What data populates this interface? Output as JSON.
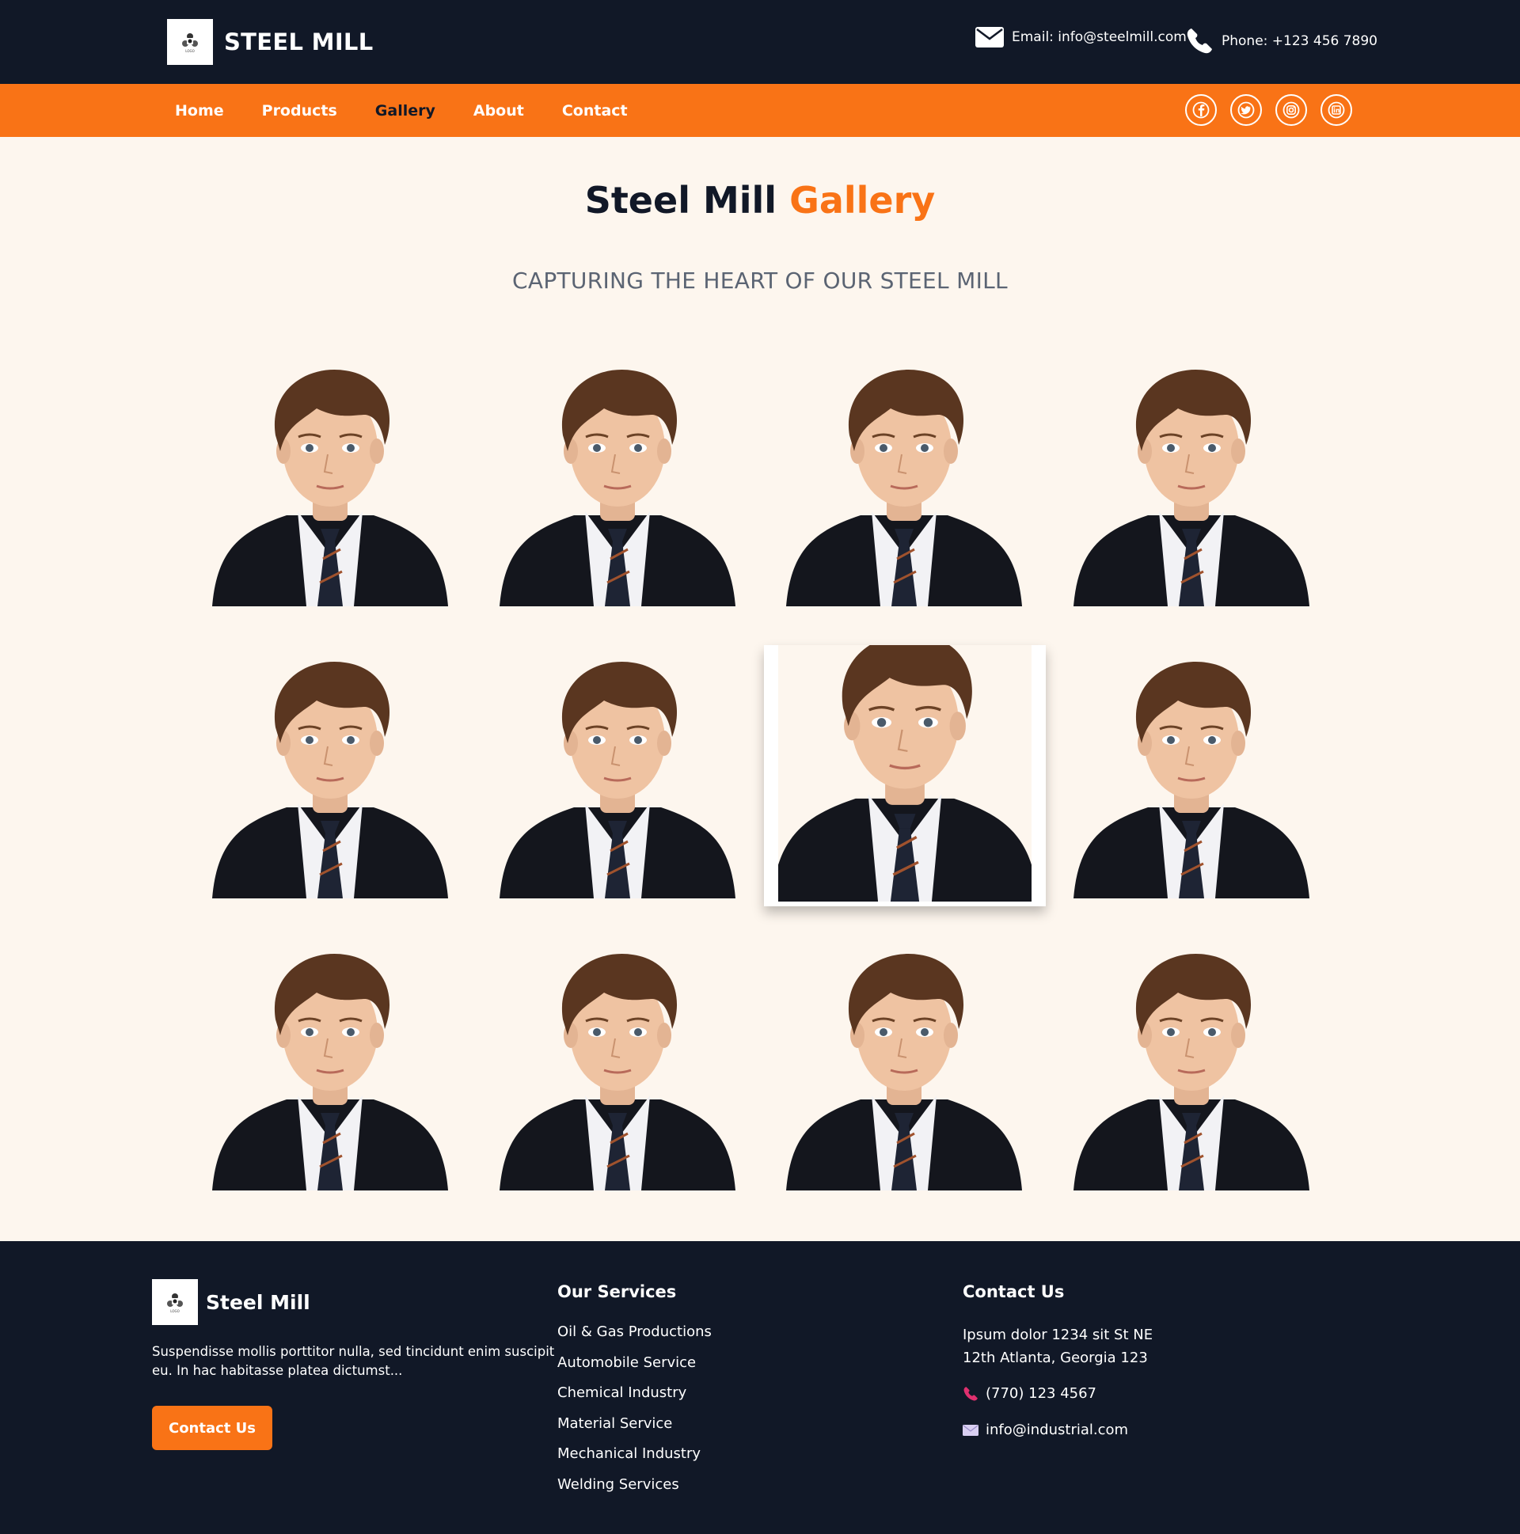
{
  "header": {
    "brand": "STEEL MILL",
    "email": "Email: info@steelmill.com",
    "phone": "Phone: +123 456 7890"
  },
  "nav": {
    "items": [
      {
        "label": "Home",
        "active": false
      },
      {
        "label": "Products",
        "active": false
      },
      {
        "label": "Gallery",
        "active": true
      },
      {
        "label": "About",
        "active": false
      },
      {
        "label": "Contact",
        "active": false
      }
    ],
    "socials": [
      "facebook-icon",
      "twitter-icon",
      "instagram-icon",
      "linkedin-icon"
    ]
  },
  "page": {
    "title_part1": "Steel Mill",
    "title_part2": "Gallery",
    "subtitle": "CAPTURING THE HEART OF OUR STEEL MILL"
  },
  "gallery": {
    "rows": 3,
    "columns": 4,
    "highlighted_index": 6
  },
  "footer": {
    "brand": "Steel Mill",
    "description": "Suspendisse mollis porttitor nulla, sed tincidunt enim suscipit eu. In hac habitasse platea dictumst...",
    "cta": "Contact Us",
    "services_title": "Our Services",
    "services": [
      "Oil & Gas Productions",
      "Automobile Service",
      "Chemical Industry",
      "Material Service",
      "Mechanical Industry",
      "Welding Services"
    ],
    "contact_title": "Contact Us",
    "address_line1": "Ipsum dolor 1234 sit St NE",
    "address_line2": "12th Atlanta, Georgia 123",
    "phone": "(770) 123 4567",
    "email": "info@industrial.com"
  },
  "colors": {
    "dark": "#111827",
    "accent": "#f97316",
    "background": "#fdf6ee"
  }
}
